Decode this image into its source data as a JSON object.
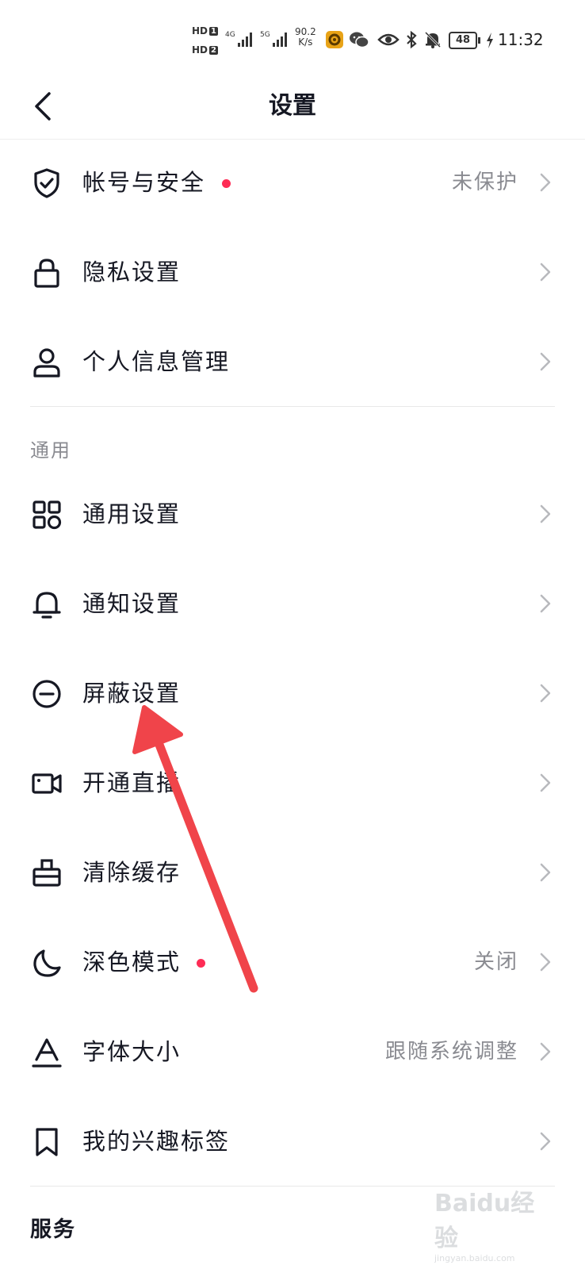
{
  "status_bar": {
    "hd1": "HD",
    "hd1_num": "1",
    "hd2": "HD",
    "hd2_num": "2",
    "net1": "4G",
    "net2": "5G",
    "speed_value": "90.2",
    "speed_unit": "K/s",
    "battery": "48",
    "time": "11:32"
  },
  "header": {
    "title": "设置"
  },
  "account_items": [
    {
      "label": "帐号与安全",
      "value": "未保护",
      "dot": true,
      "icon": "shield-check-icon"
    },
    {
      "label": "隐私设置",
      "value": "",
      "dot": false,
      "icon": "lock-icon"
    },
    {
      "label": "个人信息管理",
      "value": "",
      "dot": false,
      "icon": "user-icon"
    }
  ],
  "section_general": "通用",
  "general_items": [
    {
      "label": "通用设置",
      "value": "",
      "dot": false,
      "icon": "grid-icon"
    },
    {
      "label": "通知设置",
      "value": "",
      "dot": false,
      "icon": "bell-icon"
    },
    {
      "label": "屏蔽设置",
      "value": "",
      "dot": false,
      "icon": "block-icon"
    },
    {
      "label": "开通直播",
      "value": "",
      "dot": false,
      "icon": "video-camera-icon"
    },
    {
      "label": "清除缓存",
      "value": "",
      "dot": false,
      "icon": "clean-icon"
    },
    {
      "label": "深色模式",
      "value": "关闭",
      "dot": true,
      "icon": "moon-icon"
    },
    {
      "label": "字体大小",
      "value": "跟随系统调整",
      "dot": false,
      "icon": "font-size-icon"
    },
    {
      "label": "我的兴趣标签",
      "value": "",
      "dot": false,
      "icon": "bookmark-icon"
    }
  ],
  "section_service": "服务",
  "watermark": {
    "text": "Baidu经验",
    "url": "jingyan.baidu.com"
  },
  "colors": {
    "accent_dot": "#fe2c55",
    "arrow": "#f0444a",
    "text": "#161823",
    "secondary": "#8a8b91"
  }
}
